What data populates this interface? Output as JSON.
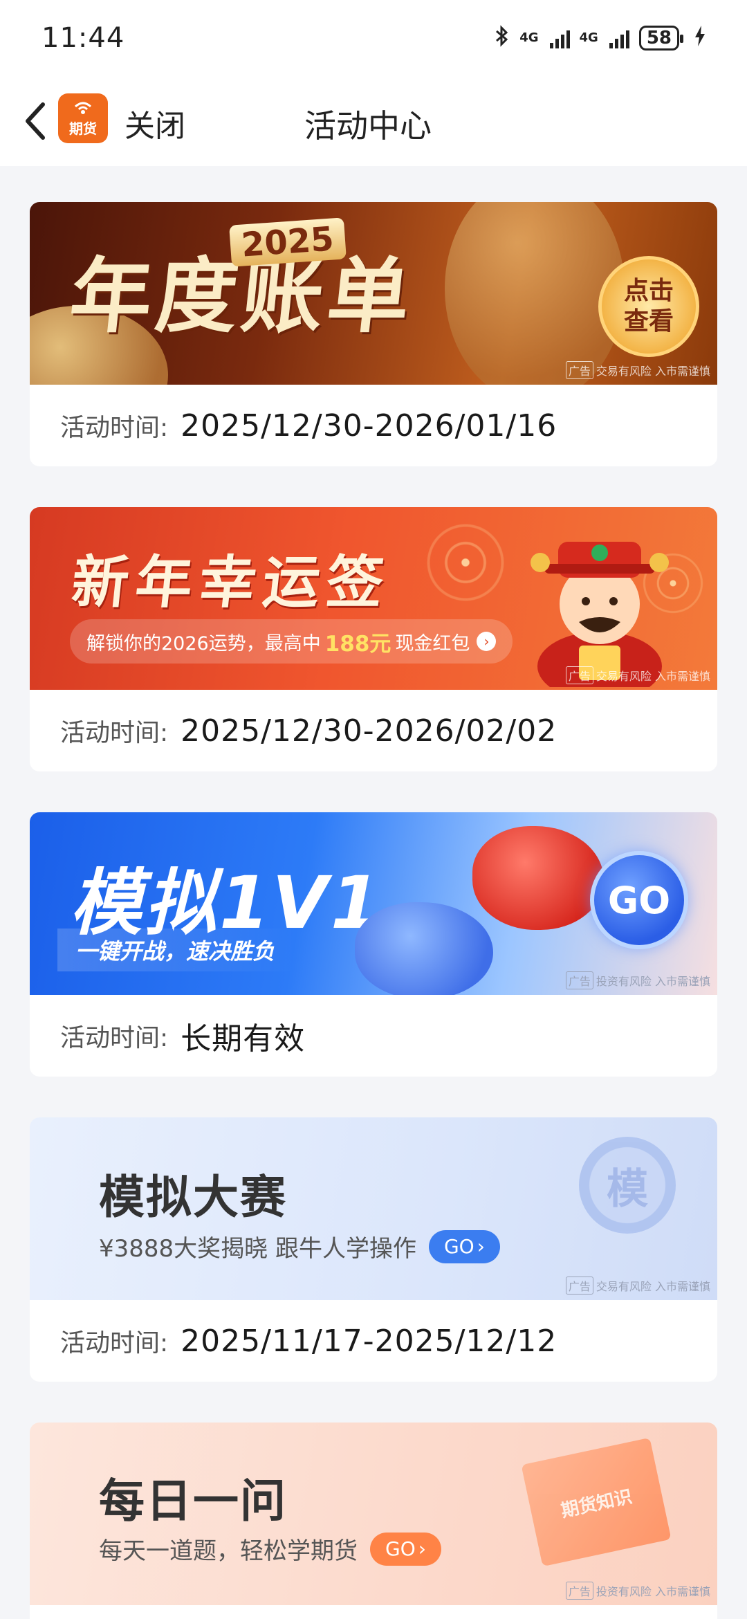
{
  "status_bar": {
    "time": "11:44",
    "network_1": "4G",
    "network_2": "4G",
    "battery": "58",
    "icons": [
      "bluetooth-icon",
      "signal-icon",
      "signal-icon",
      "battery-icon",
      "charging-icon"
    ]
  },
  "nav": {
    "app_logo_text": "期货",
    "close_label": "关闭",
    "title": "活动中心"
  },
  "colors": {
    "brand_orange": "#f06a1c",
    "background": "#f4f5f8",
    "go_blue": "#3b7df0",
    "go_orange": "#ff8346"
  },
  "time_label": "活动时间:",
  "activities": [
    {
      "banner_title": "年度账单",
      "banner_year": "2025",
      "banner_button": "点击查看",
      "ad_tag": "广告",
      "ad_note": "交易有风险 入市需谨慎",
      "time": "2025/12/30-2026/01/16"
    },
    {
      "banner_title": "新年幸运签",
      "banner_sub_prefix": "解锁你的2026运势，最高中",
      "banner_sub_highlight": "188元",
      "banner_sub_suffix": "现金红包",
      "ad_tag": "广告",
      "ad_note": "交易有风险 入市需谨慎",
      "time": "2025/12/30-2026/02/02"
    },
    {
      "banner_title": "模拟1V1",
      "banner_sub": "一键开战，速决胜负",
      "banner_button": "GO",
      "ad_tag": "广告",
      "ad_note": "投资有风险 入市需谨慎",
      "time": "长期有效"
    },
    {
      "banner_title": "模拟大赛",
      "banner_sub": "¥3888大奖揭晓  跟牛人学操作",
      "banner_button": "GO",
      "medal_char": "模",
      "ad_tag": "广告",
      "ad_note": "交易有风险 入市需谨慎",
      "time": "2025/11/17-2025/12/12"
    },
    {
      "banner_title": "每日一问",
      "banner_sub": "每天一道题，轻松学期货",
      "banner_button": "GO",
      "book_text": "期货知识",
      "ad_tag": "广告",
      "ad_note": "投资有风险 入市需谨慎"
    }
  ]
}
